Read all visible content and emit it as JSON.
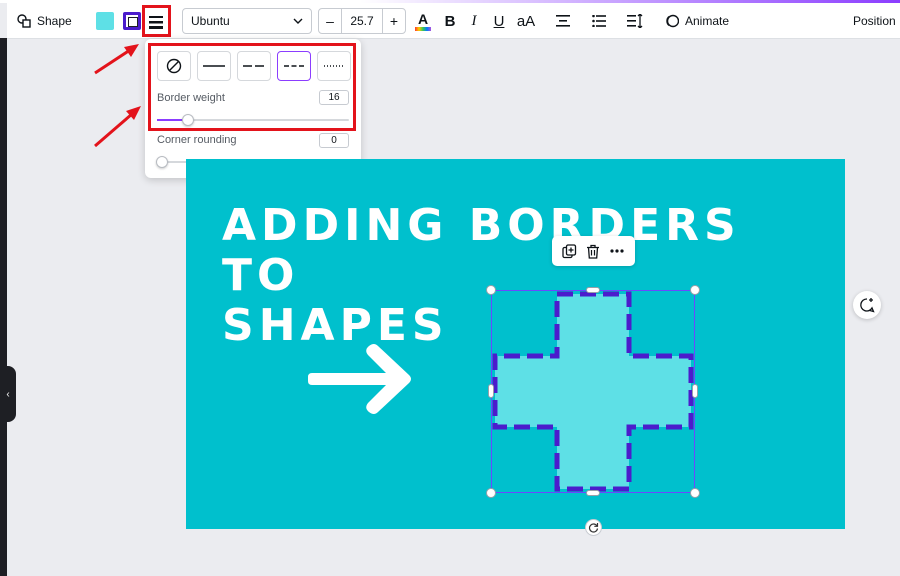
{
  "toolbar": {
    "shape_label": "Shape",
    "fill_color": "#5ee0e6",
    "border_color": "#4b1ccc",
    "font_name": "Ubuntu",
    "font_size": "25.7",
    "decrease_label": "–",
    "increase_label": "+",
    "text_color_glyph": "A",
    "bold_glyph": "B",
    "italic_glyph": "I",
    "underline_glyph": "U",
    "case_glyph": "aA",
    "animate_label": "Animate",
    "position_label": "Position"
  },
  "border_panel": {
    "styles": [
      {
        "name": "none",
        "selected": false
      },
      {
        "name": "solid",
        "selected": false
      },
      {
        "name": "long-dash",
        "selected": false
      },
      {
        "name": "short-dash",
        "selected": true
      },
      {
        "name": "dotted",
        "selected": false
      }
    ],
    "weight_label": "Border weight",
    "weight_value": "16",
    "weight_fraction": 0.16,
    "rounding_label": "Corner rounding",
    "rounding_value": "0",
    "rounding_fraction": 0
  },
  "canvas": {
    "background": "#00c0cd",
    "headline_line1": "ADDING BORDERS TO",
    "headline_line2": "SHAPES",
    "shape_fill": "#5ee0e6",
    "shape_border": "#4b1ccc"
  },
  "icons": {
    "shape": "shape-icon",
    "chevron": "chevron-down-icon",
    "duplicate": "duplicate-icon",
    "trash": "trash-icon",
    "more": "more-icon",
    "rotate": "rotate-icon",
    "comment": "add-comment-icon",
    "collapse": "chevron-left-icon"
  },
  "annotation_color": "#e3131b"
}
